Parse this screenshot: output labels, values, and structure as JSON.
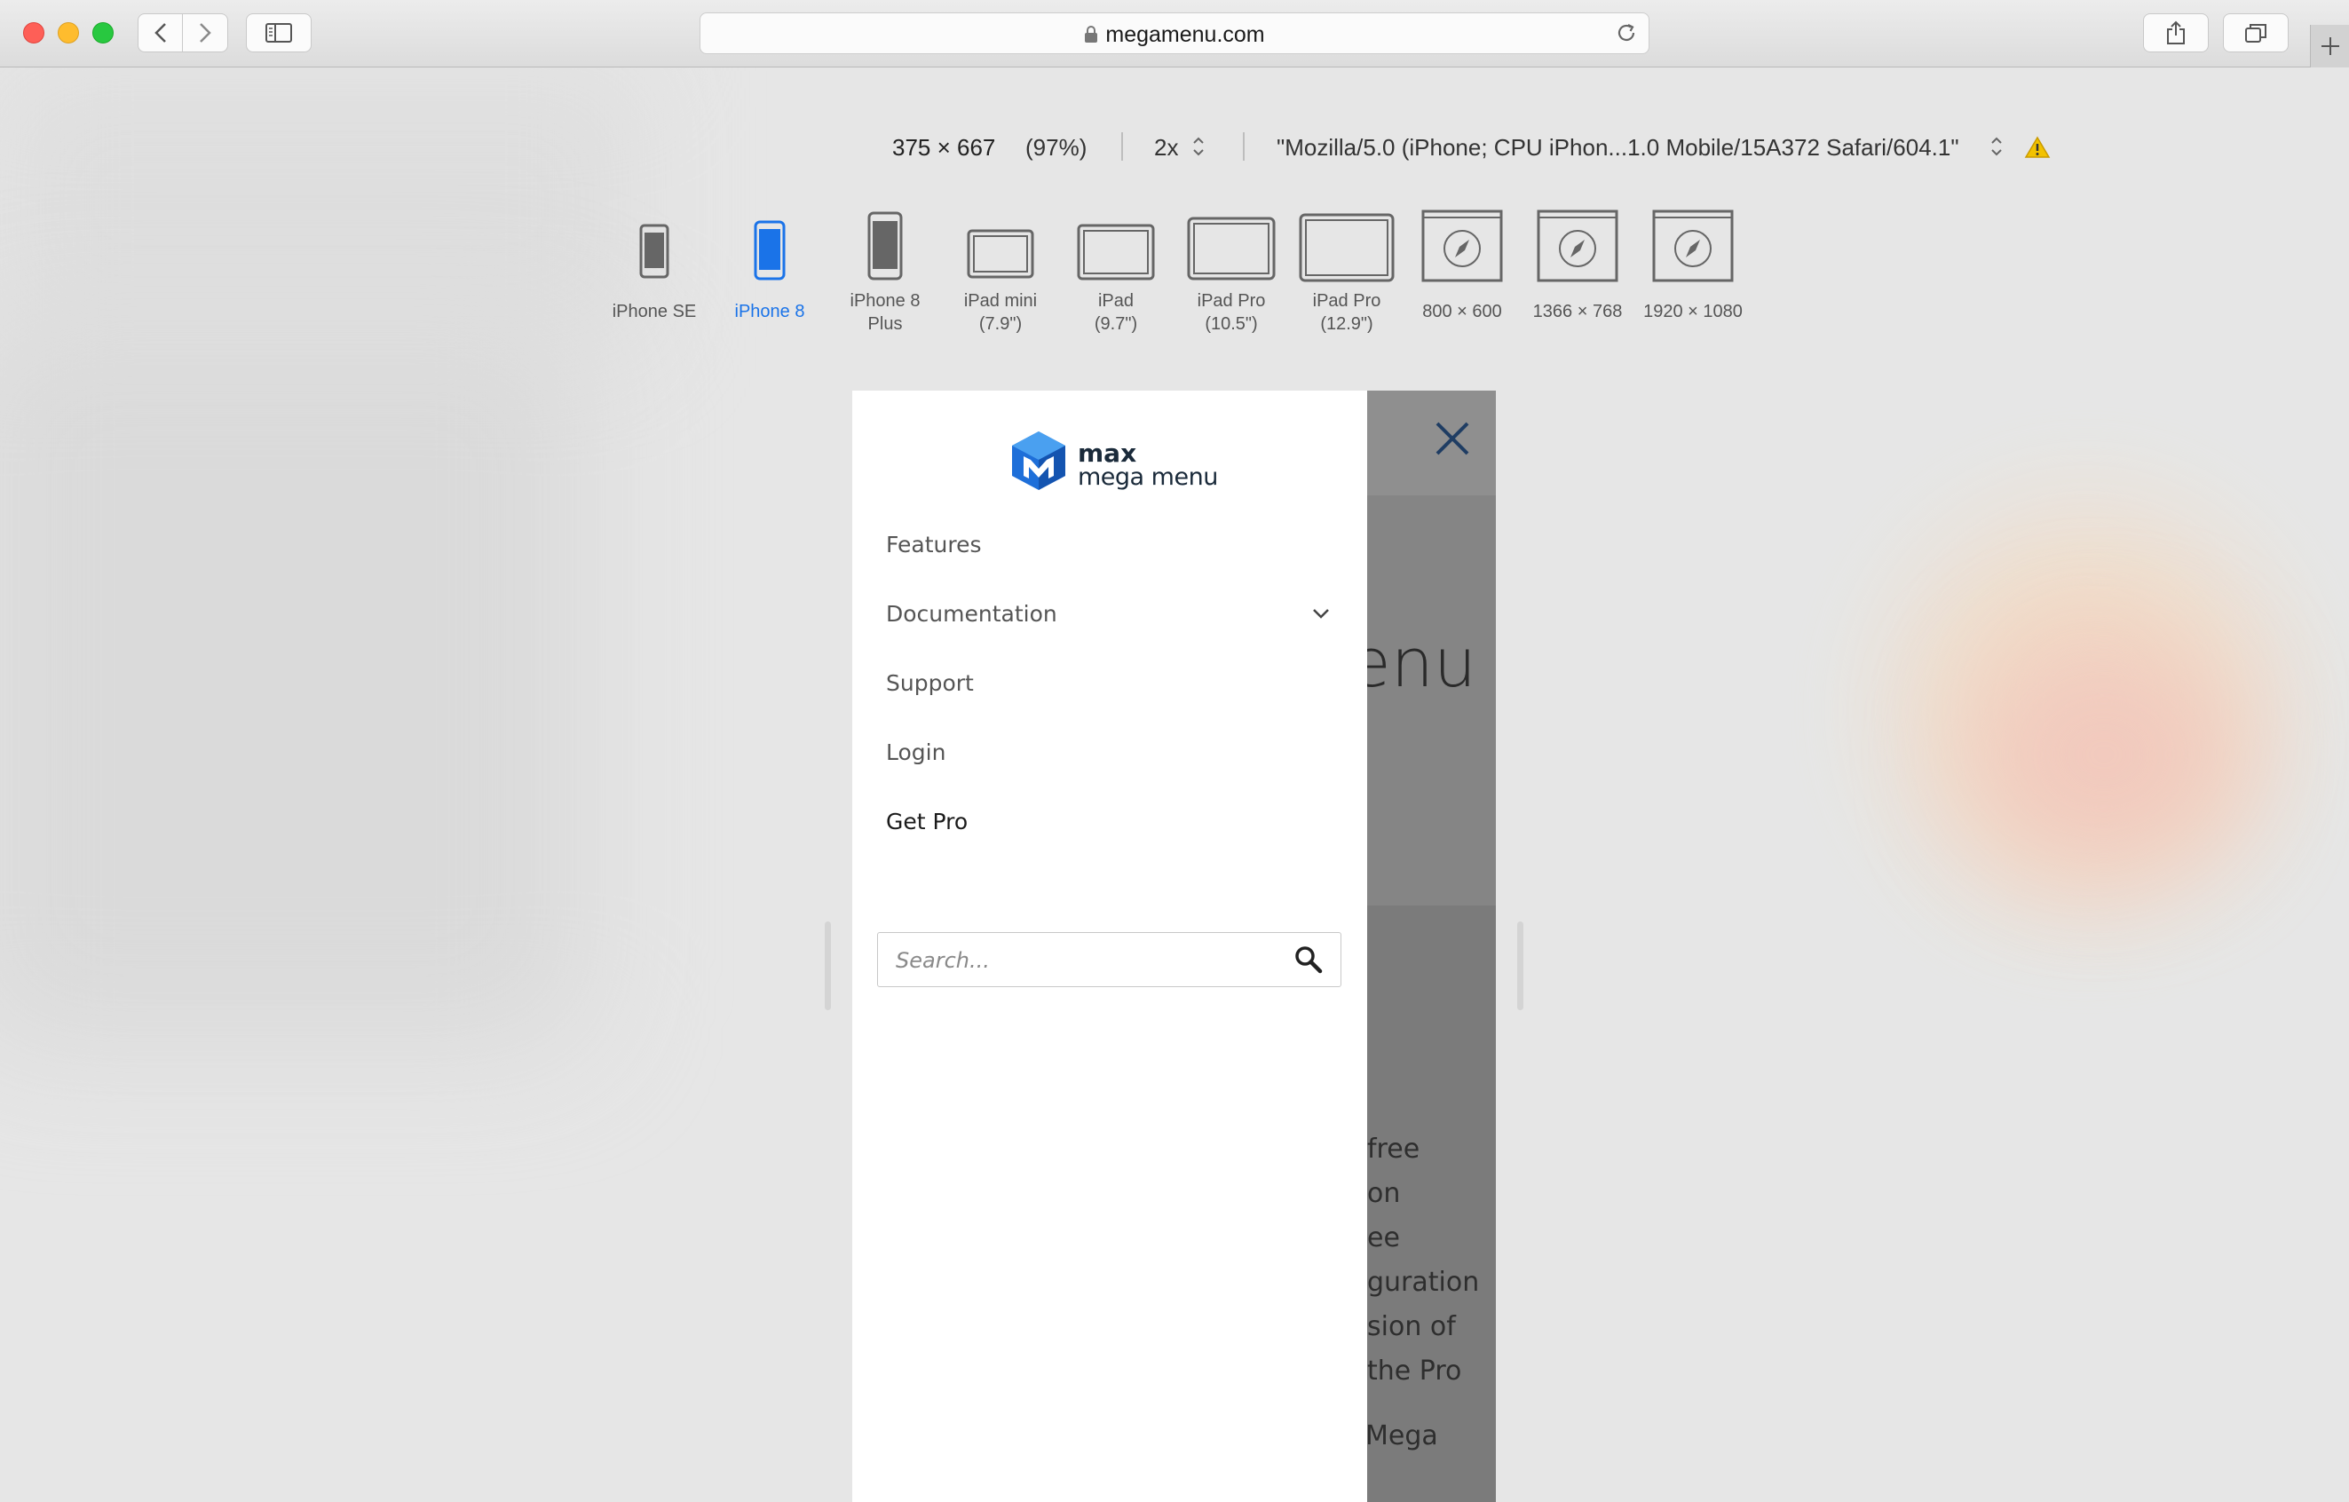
{
  "browser": {
    "url": "megamenu.com"
  },
  "responsive_bar": {
    "size": "375 × 667",
    "zoom": "(97%)",
    "scale": "2x",
    "user_agent": "\"Mozilla/5.0 (iPhone; CPU iPhon...1.0 Mobile/15A372 Safari/604.1\""
  },
  "devices": [
    {
      "label": "iPhone SE",
      "label2": ""
    },
    {
      "label": "iPhone 8",
      "label2": ""
    },
    {
      "label": "iPhone 8",
      "label2": "Plus"
    },
    {
      "label": "iPad mini",
      "label2": "(7.9\")"
    },
    {
      "label": "iPad",
      "label2": "(9.7\")"
    },
    {
      "label": "iPad Pro",
      "label2": "(10.5\")"
    },
    {
      "label": "iPad Pro",
      "label2": "(12.9\")"
    },
    {
      "label": "800 × 600",
      "label2": ""
    },
    {
      "label": "1366 × 768",
      "label2": ""
    },
    {
      "label": "1920 × 1080",
      "label2": ""
    }
  ],
  "active_device": "iPhone 8",
  "logo": {
    "word1": "max",
    "word2": "mega menu"
  },
  "menu": {
    "items": [
      "Features",
      "Documentation",
      "Support",
      "Login",
      "Get Pro"
    ]
  },
  "search": {
    "placeholder": "Search..."
  },
  "page_behind": {
    "heading_fragment": "enu",
    "paragraph_fragments": [
      "free",
      "on",
      "ee",
      "guration",
      "sion of",
      "the Pro"
    ],
    "fragment_bottom": "Mega"
  },
  "colors": {
    "accent": "#1a73e8",
    "logo_blue": "#1e6fd9",
    "close_x": "#1f3d63"
  }
}
